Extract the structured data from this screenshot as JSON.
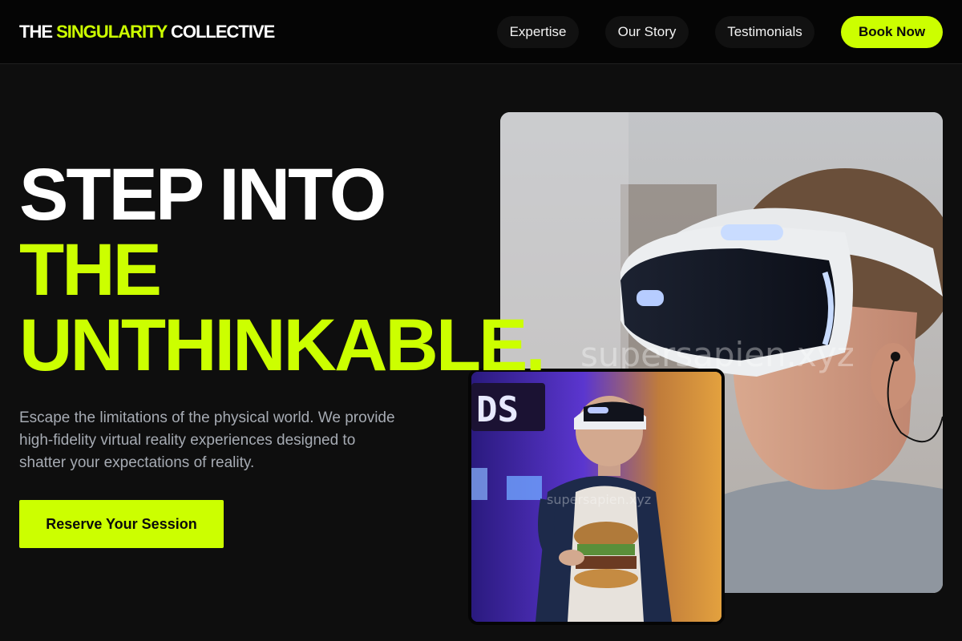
{
  "brand": {
    "name_start": "THE ",
    "name_accent": "SINGULARITY",
    "name_end": " COLLECTIVE",
    "accent_color": "#ccff00"
  },
  "nav": {
    "links": [
      "Expertise",
      "Our Story",
      "Testimonials"
    ],
    "book_label": "Book Now"
  },
  "hero": {
    "title_line1": "STEP INTO",
    "title_line2": "THE",
    "title_line3": "UNTHINKABLE.",
    "description": "Escape the limitations of the physical world. We provide high-fidelity virtual reality experiences designed to shatter your expectations of reality.",
    "cta_label": "Reserve Your Session"
  },
  "images": {
    "main_watermark": "supersapien.xyz",
    "small_watermark": "supersapien.xyz"
  }
}
